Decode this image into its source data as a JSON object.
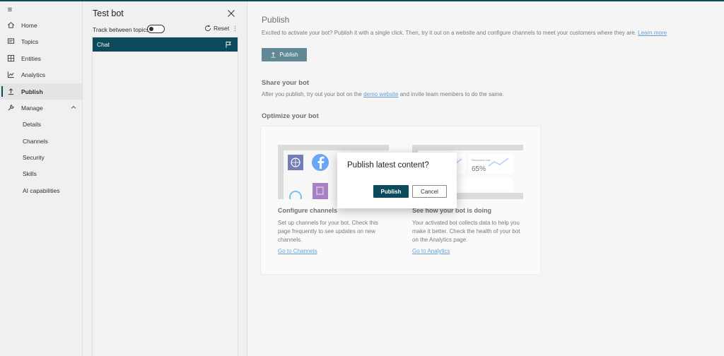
{
  "nav": {
    "items": [
      {
        "label": "Home",
        "icon": "home-icon"
      },
      {
        "label": "Topics",
        "icon": "topics-icon"
      },
      {
        "label": "Entities",
        "icon": "entities-icon"
      },
      {
        "label": "Analytics",
        "icon": "analytics-icon"
      },
      {
        "label": "Publish",
        "icon": "publish-icon",
        "active": true
      },
      {
        "label": "Manage",
        "icon": "manage-icon",
        "expanded": true
      }
    ],
    "sub_items": [
      "Details",
      "Channels",
      "Security",
      "Skills",
      "AI capabilities"
    ]
  },
  "test_panel": {
    "title": "Test bot",
    "track_label": "Track between topics",
    "reset_label": "Reset",
    "more_label": "⋮",
    "chat_label": "Chat"
  },
  "main": {
    "title": "Publish",
    "description": "Excited to activate your bot? Publish it with a single click. Then, try it out on a website and configure channels to meet your customers where they are.",
    "learn_more": "Learn more",
    "publish_button": "Publish",
    "share_title": "Share your bot",
    "share_desc_pre": "After you publish, try out your bot on the",
    "share_link": "demo website",
    "share_desc_post": "and invite team members to do the same.",
    "optimize_title": "Optimize your bot",
    "cards": [
      {
        "title": "Configure channels",
        "desc": "Set up channels for your bot. Check this page frequently to see updates on new channels.",
        "link": "Go to Channels"
      },
      {
        "title": "See how your bot is doing",
        "desc": "Your activated bot collects data to help you make it better. Check the health of your bot on the Analytics page.",
        "link": "Go to Analytics"
      }
    ],
    "illus2_label": "Resolution rate",
    "illus2_value": "65%"
  },
  "dialog": {
    "title": "Publish latest content?",
    "ok_label": "Publish",
    "cancel_label": "Cancel"
  },
  "colors": {
    "accent": "#0d4a5c",
    "link": "#0f6cbd"
  }
}
